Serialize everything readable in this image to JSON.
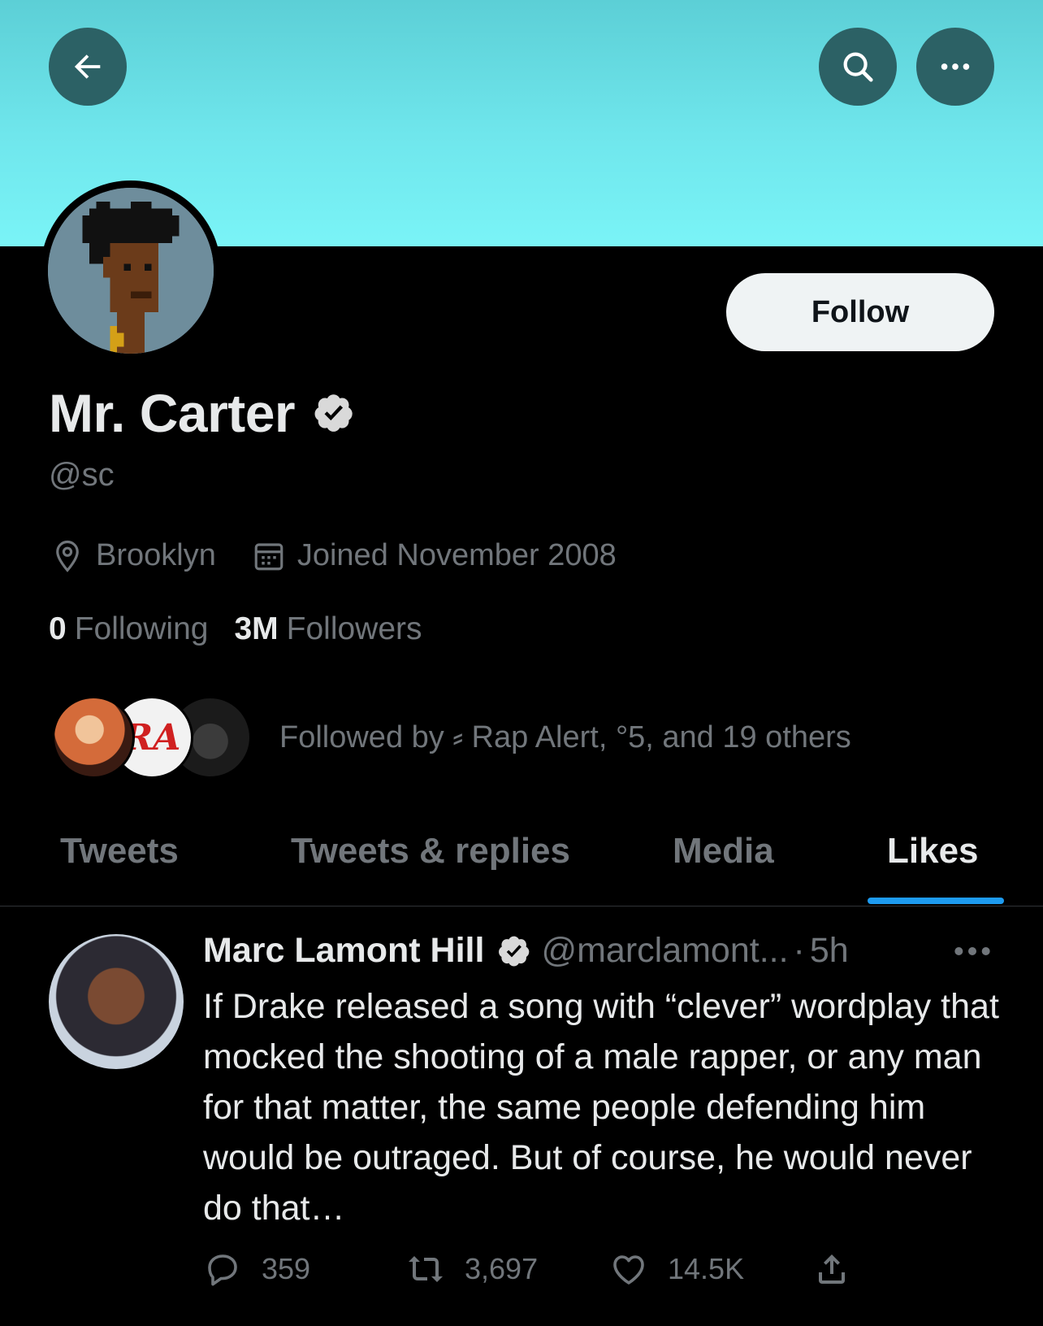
{
  "profile": {
    "display_name": "Mr. Carter",
    "handle": "@sc",
    "location": "Brooklyn",
    "joined": "Joined November 2008",
    "following_count": "0",
    "following_label": "Following",
    "followers_count": "3M",
    "followers_label": "Followers",
    "followed_by": "Followed by ⸗ Rap Alert, °5, and 19 others",
    "follow_button": "Follow",
    "banner_color": "#6fe6ec",
    "verified": true
  },
  "tabs": [
    {
      "label": "Tweets",
      "active": false
    },
    {
      "label": "Tweets & replies",
      "active": false
    },
    {
      "label": "Media",
      "active": false
    },
    {
      "label": "Likes",
      "active": true
    }
  ],
  "tweet": {
    "author": "Marc Lamont Hill",
    "handle": "@marclamont...",
    "dot": "·",
    "time": "5h",
    "text": "If Drake released a song with “clever” wordplay that mocked the shooting of a male rapper, or any man for that matter, the same people defending him would be outraged. But of course, he would never do that…",
    "replies": "359",
    "retweets": "3,697",
    "likes": "14.5K"
  },
  "accent_color": "#1d9bf0"
}
